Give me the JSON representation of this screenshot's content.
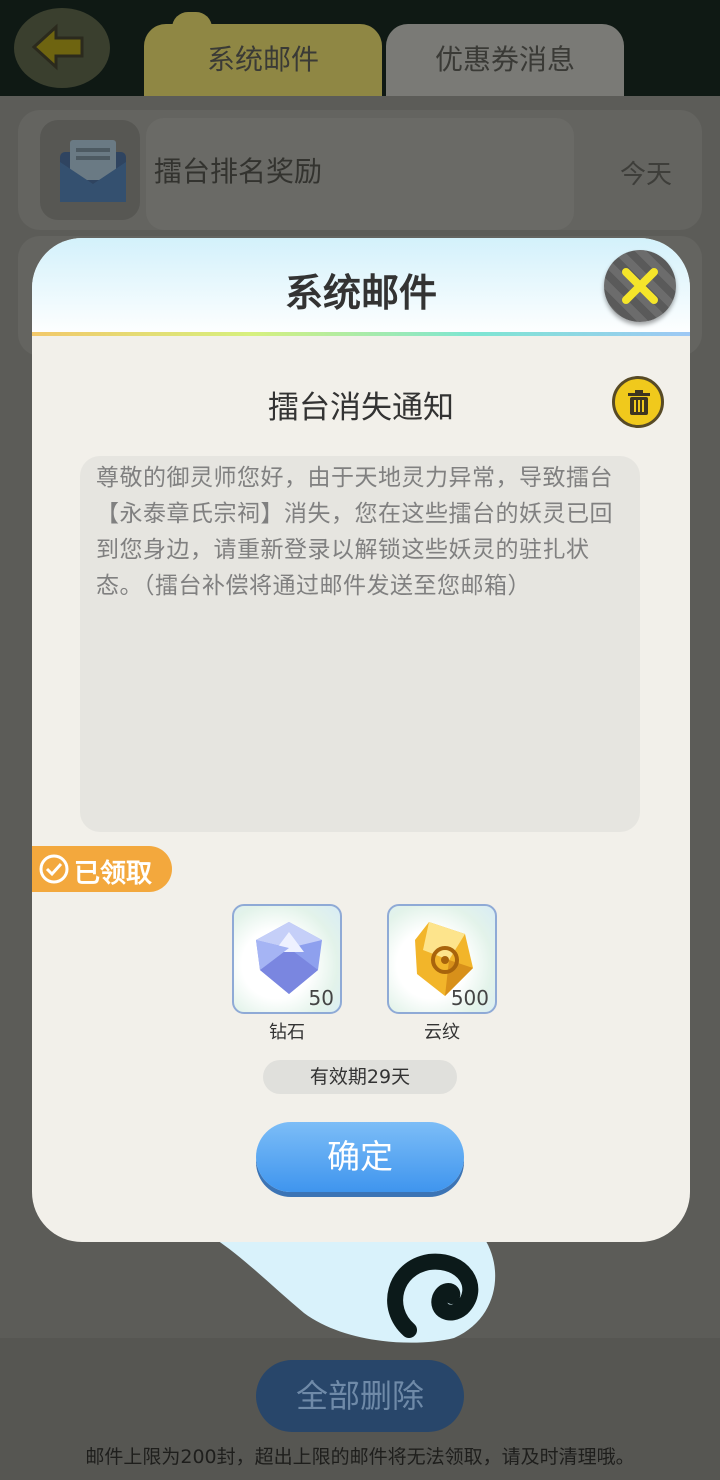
{
  "topbar": {
    "tabs": [
      {
        "label": "系统邮件",
        "active": true
      },
      {
        "label": "优惠券消息",
        "active": false
      }
    ]
  },
  "mail_list": {
    "items": [
      {
        "subject": "擂台排名奖励",
        "date": "今天"
      }
    ]
  },
  "bottom": {
    "delete_all_label": "全部删除",
    "limit_note": "邮件上限为200封，超出上限的邮件将无法领取，请及时清理哦。"
  },
  "modal": {
    "title": "系统邮件",
    "mail_title": "擂台消失通知",
    "content": "尊敬的御灵师您好，由于天地灵力异常，导致擂台【永泰章氏宗祠】消失，您在这些擂台的妖灵已回到您身边，请重新登录以解锁这些妖灵的驻扎状态。（擂台补偿将通过邮件发送至您邮箱）",
    "claimed_label": "已领取",
    "rewards": [
      {
        "name": "钻石",
        "qty": "50",
        "icon": "diamond-icon"
      },
      {
        "name": "云纹",
        "qty": "500",
        "icon": "cloud-pattern-icon"
      }
    ],
    "validity": "有效期29天",
    "confirm_label": "确定"
  },
  "colors": {
    "accent_blue": "#4a9ff0",
    "claimed_orange": "#f3a83d",
    "close_yellow": "#f5e52a"
  }
}
